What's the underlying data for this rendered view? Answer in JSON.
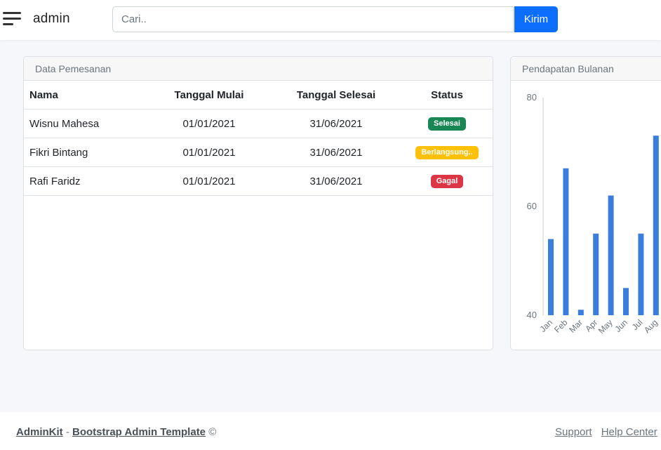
{
  "navbar": {
    "brand": "admin",
    "search_placeholder": "Cari..",
    "search_button": "Kirim"
  },
  "orders_card": {
    "title": "Data Pemesanan",
    "columns": [
      "Nama",
      "Tanggal Mulai",
      "Tanggal Selesai",
      "Status"
    ],
    "rows": [
      {
        "name": "Wisnu Mahesa",
        "start": "01/01/2021",
        "end": "31/06/2021",
        "status": "Selesai",
        "status_color": "#198754"
      },
      {
        "name": "Fikri Bintang",
        "start": "01/01/2021",
        "end": "31/06/2021",
        "status": "Berlangsung..",
        "status_color": "#ffc107"
      },
      {
        "name": "Rafi Faridz",
        "start": "01/01/2021",
        "end": "31/06/2021",
        "status": "Gagal",
        "status_color": "#dc3545"
      }
    ]
  },
  "revenue_card": {
    "title": "Pendapatan Bulanan"
  },
  "chart_data": {
    "type": "bar",
    "title": "",
    "xlabel": "",
    "ylabel": "",
    "categories": [
      "Jan",
      "Feb",
      "Mar",
      "Apr",
      "May",
      "Jun",
      "Jul",
      "Aug"
    ],
    "values": [
      54,
      67,
      41,
      55,
      62,
      45,
      55,
      73
    ],
    "yticks": [
      40,
      60,
      80
    ],
    "ylim": [
      40,
      80
    ],
    "bar_color": "#3b7ddd",
    "grid": false
  },
  "footer": {
    "brand": "AdminKit",
    "separator": "-",
    "template_link": "Bootstrap Admin Template",
    "copyright": "©",
    "links": [
      "Support",
      "Help Center"
    ]
  }
}
